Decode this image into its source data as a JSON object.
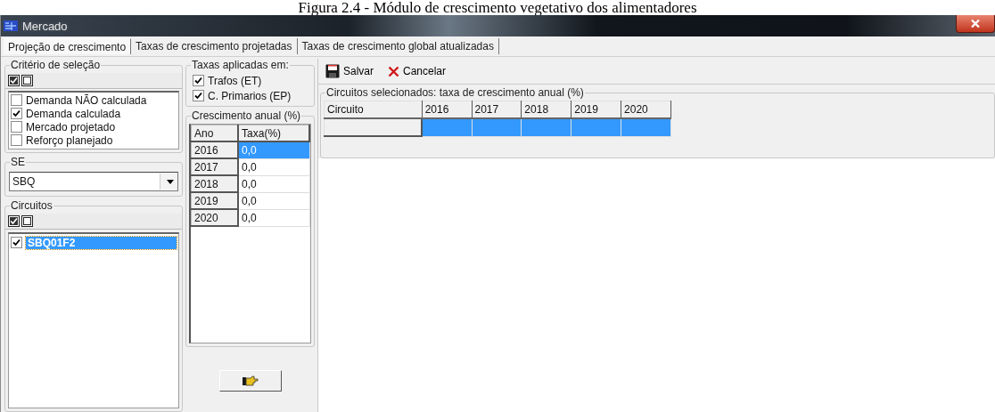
{
  "caption": "Figura 2.4 - Módulo de crescimento vegetativo dos alimentadores",
  "window": {
    "title": "Mercado"
  },
  "tabs": [
    {
      "label": "Projeção de crescimento",
      "selected": true
    },
    {
      "label": "Taxas de crescimento projetadas",
      "selected": false
    },
    {
      "label": "Taxas de crescimento global atualizadas",
      "selected": false
    }
  ],
  "selection_criteria": {
    "title": "Critério de seleção",
    "options": [
      {
        "label": "Demanda NÃO calculada",
        "checked": false
      },
      {
        "label": "Demanda calculada",
        "checked": true
      },
      {
        "label": "Mercado projetado",
        "checked": false
      },
      {
        "label": "Reforço planejado",
        "checked": false
      }
    ]
  },
  "se": {
    "title": "SE",
    "value": "SBQ"
  },
  "circuits": {
    "title": "Circuitos",
    "items": [
      {
        "label": "SBQ01F2",
        "checked": true,
        "selected": true
      }
    ]
  },
  "rates_applied": {
    "title": "Taxas aplicadas em:",
    "options": [
      {
        "label": "Trafos (ET)",
        "checked": true
      },
      {
        "label": "C. Primarios (EP)",
        "checked": true
      }
    ]
  },
  "annual_growth": {
    "title": "Crescimento anual (%)",
    "columns": [
      "Ano",
      "Taxa(%)"
    ],
    "rows": [
      {
        "year": "2016",
        "rate": "0,0",
        "selected": true
      },
      {
        "year": "2017",
        "rate": "0,0",
        "selected": false
      },
      {
        "year": "2018",
        "rate": "0,0",
        "selected": false
      },
      {
        "year": "2019",
        "rate": "0,0",
        "selected": false
      },
      {
        "year": "2020",
        "rate": "0,0",
        "selected": false
      }
    ]
  },
  "toolbar": [
    {
      "label": "Salvar",
      "kind": "save"
    },
    {
      "label": "Cancelar",
      "kind": "cancel"
    }
  ],
  "selected_circuits": {
    "title": "Circuitos selecionados: taxa de crescimento anual (%)",
    "columns": [
      "Circuito",
      "2016",
      "2017",
      "2018",
      "2019",
      "2020"
    ],
    "rows": [
      {
        "selected": true
      }
    ]
  }
}
